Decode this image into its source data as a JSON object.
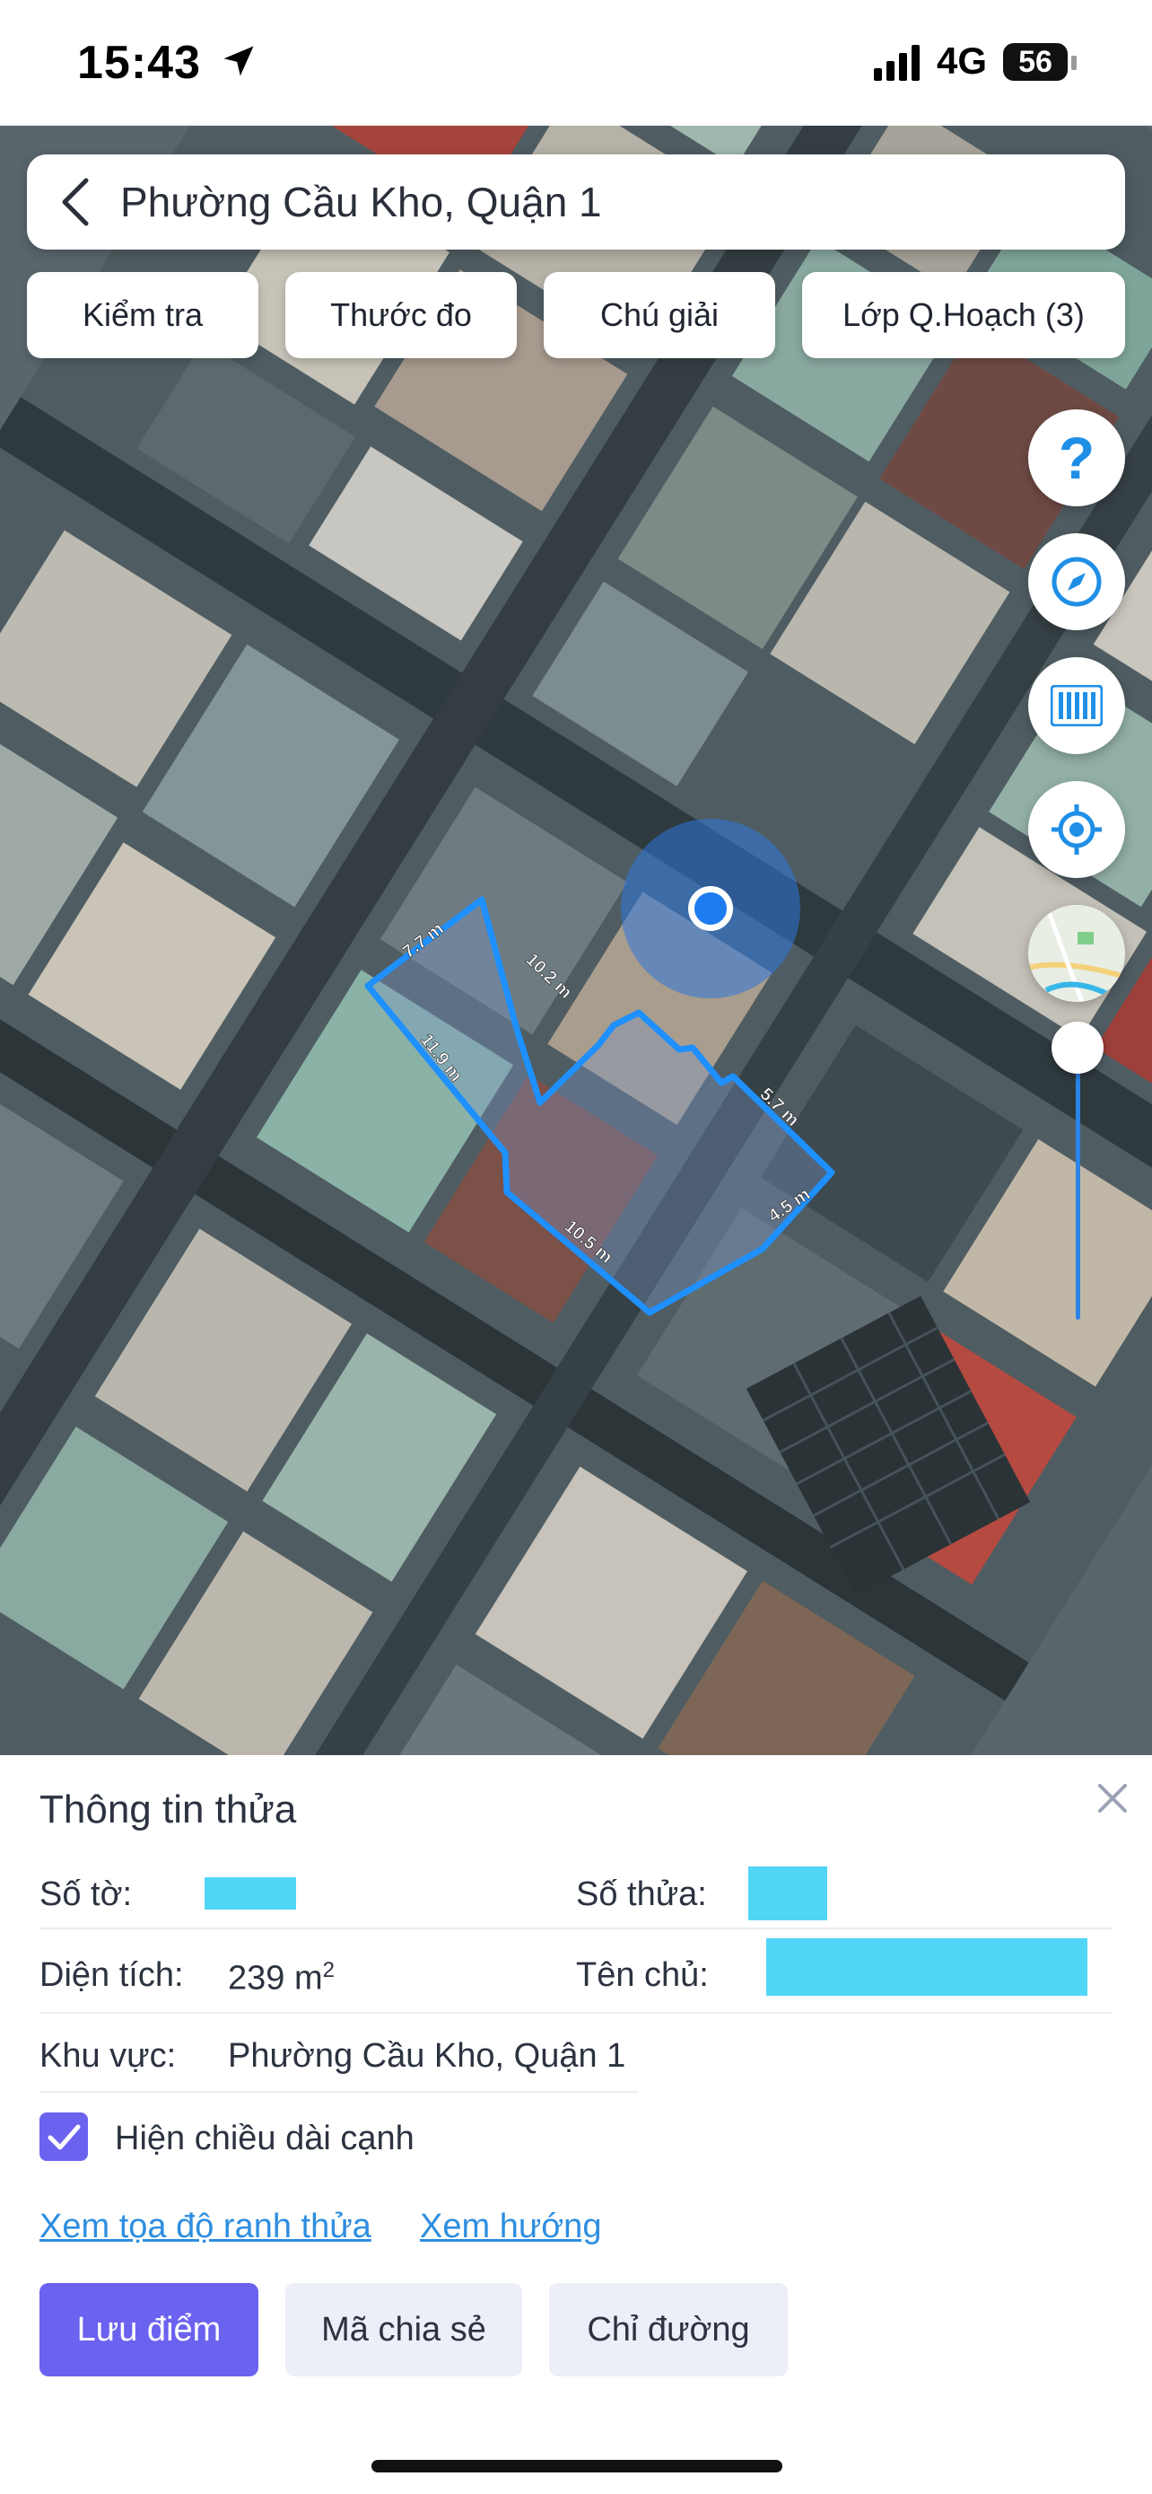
{
  "status_bar": {
    "time": "15:43",
    "network": "4G",
    "battery": "56"
  },
  "search": {
    "title": "Phường Cầu Kho, Quận 1"
  },
  "tabs": [
    {
      "label": "Kiểm tra"
    },
    {
      "label": "Thước đo"
    },
    {
      "label": "Chú giải"
    },
    {
      "label": "Lớp Q.Hoạch (3)"
    }
  ],
  "side_buttons": {
    "help": "?"
  },
  "map": {
    "parcel_edges": [
      "7.7 m",
      "10.2 m",
      "5.7 m",
      "4.5 m",
      "10.5 m",
      "11.9 m"
    ],
    "parcel_color": "#1e90ff"
  },
  "panel": {
    "title": "Thông tin thửa",
    "so_to_label": "Số tờ:",
    "so_thua_label": "Số thửa:",
    "dien_tich_label": "Diện tích:",
    "dien_tich_value": "239 m",
    "dien_tich_unit_sup": "2",
    "ten_chu_label": "Tên chủ:",
    "khu_vuc_label": "Khu vực:",
    "khu_vuc_value": "Phường Cầu Kho, Quận 1",
    "show_edges_label": "Hiện chiều dài cạnh",
    "show_edges_checked": true,
    "link_coords": "Xem tọa độ ranh thửa",
    "link_direction": "Xem hướng",
    "btn_save": "Lưu điểm",
    "btn_share": "Mã chia sẻ",
    "btn_route": "Chỉ đường"
  },
  "colors": {
    "accent": "#6b62f0",
    "link": "#2e8ee0",
    "redaction": "#51d5f6"
  }
}
